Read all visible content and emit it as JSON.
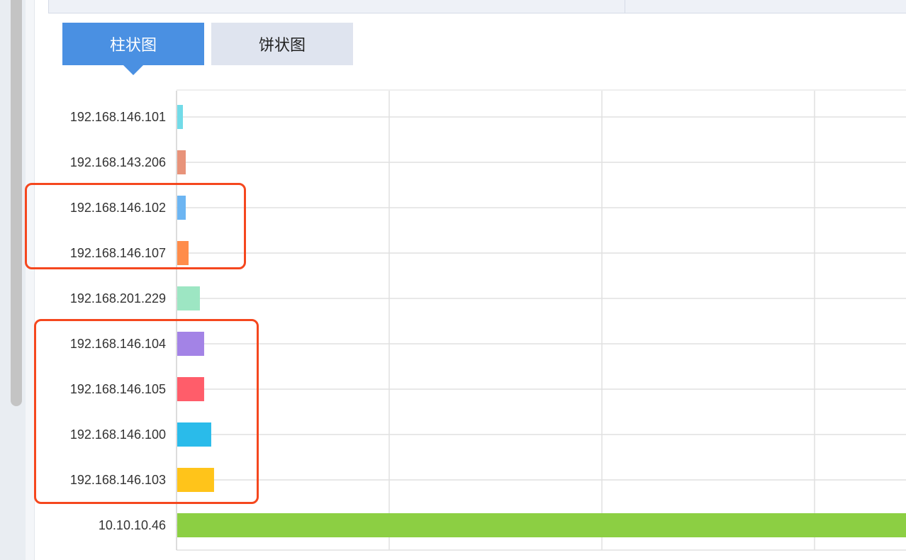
{
  "tabs": {
    "bar_label": "柱状图",
    "pie_label": "饼状图"
  },
  "chart_data": {
    "type": "bar",
    "orientation": "horizontal",
    "categories": [
      "192.168.146.101",
      "192.168.143.206",
      "192.168.146.102",
      "192.168.146.107",
      "192.168.201.229",
      "192.168.146.104",
      "192.168.146.105",
      "192.168.146.100",
      "192.168.146.103",
      "10.10.10.46"
    ],
    "values": [
      8,
      12,
      12,
      16,
      32,
      38,
      38,
      48,
      52,
      1030
    ],
    "colors": [
      "#72dbe8",
      "#e8937a",
      "#6cb5f2",
      "#ff8c4a",
      "#9de6c3",
      "#a383e6",
      "#ff5d6a",
      "#2abbea",
      "#ffc41a",
      "#8ccf43"
    ],
    "xlim": [
      0,
      1030
    ],
    "grid": true,
    "legend": "none"
  },
  "annotation_color": "#f5471e"
}
